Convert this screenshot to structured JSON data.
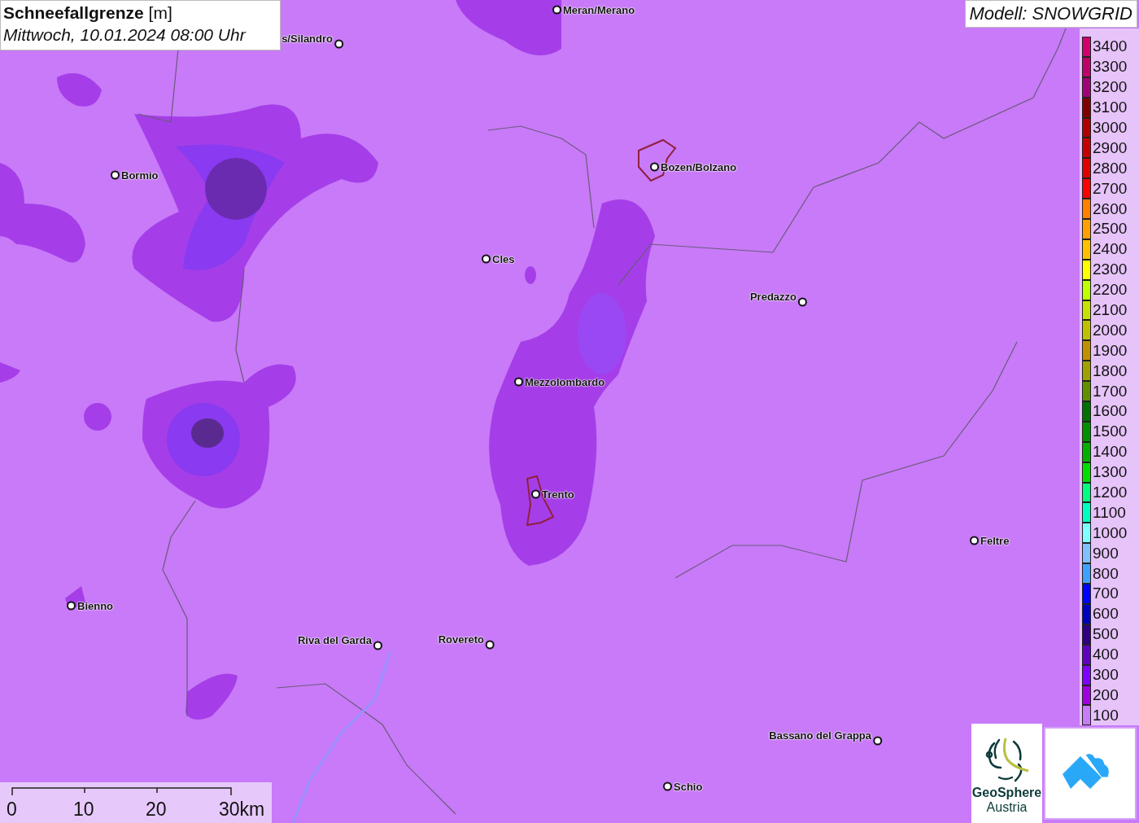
{
  "header": {
    "title": "**Schneefallgrenze** [m]",
    "subtitle": "Mittwoch, 10.01.2024 08:00 Uhr"
  },
  "model": {
    "label": "Modell: SNOWGRID"
  },
  "places": [
    {
      "name": "Meran/Merano"
    },
    {
      "name": "s/Silandro"
    },
    {
      "name": "Bormio"
    },
    {
      "name": "Bozen/Bolzano"
    },
    {
      "name": "Cles"
    },
    {
      "name": "Predazzo"
    },
    {
      "name": "Mezzolombardo"
    },
    {
      "name": "Trento"
    },
    {
      "name": "Feltre"
    },
    {
      "name": "Bienno"
    },
    {
      "name": "Riva del Garda"
    },
    {
      "name": "Rovereto"
    },
    {
      "name": "Bassano del Grappa"
    },
    {
      "name": "Schio"
    }
  ],
  "legend": [
    {
      "label": "3400",
      "color": "#d0006f"
    },
    {
      "label": "3300",
      "color": "#c0006a"
    },
    {
      "label": "3200",
      "color": "#a00078"
    },
    {
      "label": "3100",
      "color": "#800000"
    },
    {
      "label": "3000",
      "color": "#b00000"
    },
    {
      "label": "2900",
      "color": "#c80000"
    },
    {
      "label": "2800",
      "color": "#e00000"
    },
    {
      "label": "2700",
      "color": "#ff0000"
    },
    {
      "label": "2600",
      "color": "#ff8000"
    },
    {
      "label": "2500",
      "color": "#ffa000"
    },
    {
      "label": "2400",
      "color": "#ffc000"
    },
    {
      "label": "2300",
      "color": "#ffff00"
    },
    {
      "label": "2200",
      "color": "#c0ff00"
    },
    {
      "label": "2100",
      "color": "#c8e000"
    },
    {
      "label": "2000",
      "color": "#c0c000"
    },
    {
      "label": "1900",
      "color": "#c09000"
    },
    {
      "label": "1800",
      "color": "#a0a000"
    },
    {
      "label": "1700",
      "color": "#609000"
    },
    {
      "label": "1600",
      "color": "#007000"
    },
    {
      "label": "1500",
      "color": "#009000"
    },
    {
      "label": "1400",
      "color": "#00b000"
    },
    {
      "label": "1300",
      "color": "#00e000"
    },
    {
      "label": "1200",
      "color": "#00ff80"
    },
    {
      "label": "1100",
      "color": "#00ffc0"
    },
    {
      "label": "1000",
      "color": "#80ffff"
    },
    {
      "label": "900",
      "color": "#80c0ff"
    },
    {
      "label": "800",
      "color": "#40a0ff"
    },
    {
      "label": "700",
      "color": "#0000ff"
    },
    {
      "label": "600",
      "color": "#0000c0"
    },
    {
      "label": "500",
      "color": "#300080"
    },
    {
      "label": "400",
      "color": "#6000c0"
    },
    {
      "label": "300",
      "color": "#8000ff"
    },
    {
      "label": "200",
      "color": "#a000e0"
    },
    {
      "label": "100",
      "color": "#c87af8"
    }
  ],
  "scale_bar": {
    "labels": [
      "0",
      "10",
      "20",
      "30km"
    ]
  },
  "logo": {
    "name": "GeoSphere",
    "country": "Austria"
  }
}
